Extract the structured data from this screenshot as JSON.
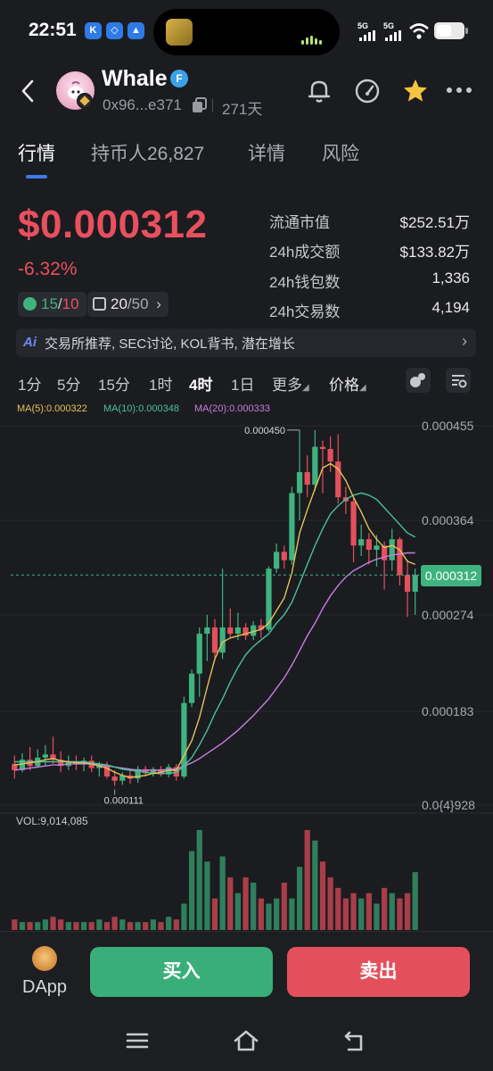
{
  "status_bar": {
    "time": "22:51",
    "app_icons": [
      "K",
      "◇",
      "▲"
    ],
    "signal_1": "5G",
    "signal_2": "5G"
  },
  "header": {
    "token_name": "Whale",
    "verified_badge": "F",
    "address": "0x96...e371",
    "age": "271天",
    "icons": [
      "back-icon",
      "copy-icon",
      "bell-icon",
      "gauge-icon",
      "star-icon",
      "more-icon"
    ]
  },
  "tabs": [
    {
      "label": "行情",
      "active": true
    },
    {
      "label": "持币人26,827",
      "active": false
    },
    {
      "label": "详情",
      "active": false
    },
    {
      "label": "风险",
      "active": false
    }
  ],
  "price": {
    "current": "$0.000312",
    "change": "-6.32%",
    "chip_1_value": "15",
    "chip_1_sep": "/",
    "chip_1_total": "10",
    "chip_2_value": "20",
    "chip_2_total": "/50",
    "chip_2_chevron": "›"
  },
  "stats": [
    {
      "label": "流通市值",
      "value": "$252.51万"
    },
    {
      "label": "24h成交额",
      "value": "$133.82万"
    },
    {
      "label": "24h钱包数",
      "value": "1,336"
    },
    {
      "label": "24h交易数",
      "value": "4,194"
    }
  ],
  "ai_banner": {
    "badge": "Ai",
    "text": "交易所推荐, SEC讨论, KOL背书, 潜在增长",
    "chevron": "›"
  },
  "intervals": [
    "1分",
    "5分",
    "15分",
    "1时",
    "4时",
    "1日",
    "更多",
    "价格"
  ],
  "active_interval": "4时",
  "ma_legend": {
    "ma5": "MA(5):0.000322",
    "ma10": "MA(10):0.000348",
    "ma20": "MA(20):0.000333"
  },
  "colors": {
    "up": "#3fb37f",
    "down": "#e3505c",
    "ma5": "#e3c35a",
    "ma10": "#46c29a",
    "ma20": "#c77de0",
    "accent": "#3c7be8"
  },
  "chart_data": {
    "type": "candlestick",
    "price_axis_labels": [
      "0.000455",
      "0.000364",
      "0.000274",
      "0.000183",
      "0.0{4}928"
    ],
    "last_price": "0.000312",
    "high_label": "0.000450",
    "low_label": "0.000111",
    "volume_label": "VOL:9,014,085",
    "ylim": [
      9.28e-05,
      0.000455
    ],
    "candles": [
      {
        "o": 0.000132,
        "h": 0.00014,
        "l": 0.000118,
        "c": 0.000126
      },
      {
        "o": 0.000126,
        "h": 0.000142,
        "l": 0.000124,
        "c": 0.000136
      },
      {
        "o": 0.000136,
        "h": 0.000148,
        "l": 0.000126,
        "c": 0.00013
      },
      {
        "o": 0.00013,
        "h": 0.000146,
        "l": 0.000128,
        "c": 0.000138
      },
      {
        "o": 0.000138,
        "h": 0.00015,
        "l": 0.00013,
        "c": 0.000141
      },
      {
        "o": 0.000141,
        "h": 0.000158,
        "l": 0.000132,
        "c": 0.000136
      },
      {
        "o": 0.000136,
        "h": 0.000144,
        "l": 0.000124,
        "c": 0.00013
      },
      {
        "o": 0.00013,
        "h": 0.00014,
        "l": 0.000126,
        "c": 0.000134
      },
      {
        "o": 0.000134,
        "h": 0.00014,
        "l": 0.000126,
        "c": 0.000132
      },
      {
        "o": 0.000132,
        "h": 0.000138,
        "l": 0.000125,
        "c": 0.000135
      },
      {
        "o": 0.000135,
        "h": 0.00014,
        "l": 0.000124,
        "c": 0.000128
      },
      {
        "o": 0.000128,
        "h": 0.000134,
        "l": 0.00012,
        "c": 0.000131
      },
      {
        "o": 0.000131,
        "h": 0.000134,
        "l": 0.000118,
        "c": 0.00012
      },
      {
        "o": 0.00012,
        "h": 0.000126,
        "l": 0.000111,
        "c": 0.000116
      },
      {
        "o": 0.000116,
        "h": 0.000124,
        "l": 0.000112,
        "c": 0.000121
      },
      {
        "o": 0.000121,
        "h": 0.000126,
        "l": 0.000113,
        "c": 0.000118
      },
      {
        "o": 0.000118,
        "h": 0.00013,
        "l": 0.000114,
        "c": 0.000127
      },
      {
        "o": 0.000127,
        "h": 0.00013,
        "l": 0.00012,
        "c": 0.000123
      },
      {
        "o": 0.000123,
        "h": 0.000129,
        "l": 0.00012,
        "c": 0.000127
      },
      {
        "o": 0.000127,
        "h": 0.00013,
        "l": 0.00012,
        "c": 0.000122
      },
      {
        "o": 0.000122,
        "h": 0.000132,
        "l": 0.000119,
        "c": 0.000129
      },
      {
        "o": 0.000129,
        "h": 0.000132,
        "l": 0.000116,
        "c": 0.00012
      },
      {
        "o": 0.00012,
        "h": 0.000196,
        "l": 0.000118,
        "c": 0.00019
      },
      {
        "o": 0.00019,
        "h": 0.000222,
        "l": 0.000186,
        "c": 0.000218
      },
      {
        "o": 0.000218,
        "h": 0.000262,
        "l": 0.000196,
        "c": 0.000256
      },
      {
        "o": 0.000256,
        "h": 0.000274,
        "l": 0.00023,
        "c": 0.000262
      },
      {
        "o": 0.000262,
        "h": 0.00027,
        "l": 0.000232,
        "c": 0.000238
      },
      {
        "o": 0.000238,
        "h": 0.000318,
        "l": 0.000232,
        "c": 0.000262
      },
      {
        "o": 0.000262,
        "h": 0.00028,
        "l": 0.000252,
        "c": 0.000256
      },
      {
        "o": 0.000256,
        "h": 0.000276,
        "l": 0.00025,
        "c": 0.000262
      },
      {
        "o": 0.000262,
        "h": 0.000266,
        "l": 0.00025,
        "c": 0.000254
      },
      {
        "o": 0.000254,
        "h": 0.000268,
        "l": 0.00025,
        "c": 0.000264
      },
      {
        "o": 0.000264,
        "h": 0.00027,
        "l": 0.000252,
        "c": 0.00026
      },
      {
        "o": 0.00026,
        "h": 0.00032,
        "l": 0.000258,
        "c": 0.000318
      },
      {
        "o": 0.000318,
        "h": 0.000342,
        "l": 0.000314,
        "c": 0.000334
      },
      {
        "o": 0.000334,
        "h": 0.00034,
        "l": 0.000318,
        "c": 0.000326
      },
      {
        "o": 0.000326,
        "h": 0.000396,
        "l": 0.000322,
        "c": 0.00039
      },
      {
        "o": 0.00039,
        "h": 0.00045,
        "l": 0.000364,
        "c": 0.00041
      },
      {
        "o": 0.00041,
        "h": 0.000426,
        "l": 0.000386,
        "c": 0.000398
      },
      {
        "o": 0.000398,
        "h": 0.00045,
        "l": 0.000392,
        "c": 0.000434
      },
      {
        "o": 0.000434,
        "h": 0.00044,
        "l": 0.00039,
        "c": 0.000432
      },
      {
        "o": 0.000432,
        "h": 0.000444,
        "l": 0.00041,
        "c": 0.00042
      },
      {
        "o": 0.00042,
        "h": 0.000446,
        "l": 0.00038,
        "c": 0.000386
      },
      {
        "o": 0.000386,
        "h": 0.000396,
        "l": 0.00037,
        "c": 0.000382
      },
      {
        "o": 0.000382,
        "h": 0.000386,
        "l": 0.000324,
        "c": 0.00034
      },
      {
        "o": 0.00034,
        "h": 0.00036,
        "l": 0.00033,
        "c": 0.000346
      },
      {
        "o": 0.000346,
        "h": 0.000352,
        "l": 0.000322,
        "c": 0.000336
      },
      {
        "o": 0.000336,
        "h": 0.00035,
        "l": 0.00032,
        "c": 0.00034
      },
      {
        "o": 0.00034,
        "h": 0.000344,
        "l": 0.000298,
        "c": 0.000326
      },
      {
        "o": 0.000326,
        "h": 0.000356,
        "l": 0.000316,
        "c": 0.000346
      },
      {
        "o": 0.000346,
        "h": 0.000348,
        "l": 0.000302,
        "c": 0.000312
      },
      {
        "o": 0.000312,
        "h": 0.000326,
        "l": 0.000272,
        "c": 0.000296
      },
      {
        "o": 0.000296,
        "h": 0.000318,
        "l": 0.000274,
        "c": 0.000312
      }
    ],
    "volume": [
      4,
      3,
      3,
      3,
      4,
      5,
      4,
      3,
      3,
      3,
      3,
      4,
      3,
      5,
      4,
      3,
      3,
      3,
      4,
      3,
      5,
      4,
      10,
      30,
      38,
      26,
      12,
      28,
      20,
      14,
      20,
      18,
      12,
      10,
      12,
      18,
      12,
      24,
      38,
      34,
      26,
      20,
      16,
      12,
      14,
      12,
      14,
      10,
      16,
      14,
      12,
      14,
      22
    ],
    "ma5": [
      0.000131,
      0.000132,
      0.000133,
      0.000134,
      0.000136,
      0.000137,
      0.000135,
      0.000134,
      0.000133,
      0.000133,
      0.000132,
      0.00013,
      0.000128,
      0.000124,
      0.000121,
      0.000119,
      0.00012,
      0.000121,
      0.000123,
      0.000124,
      0.000126,
      0.000126,
      0.00014,
      0.000154,
      0.000176,
      0.000205,
      0.000232,
      0.000248,
      0.000252,
      0.000254,
      0.000256,
      0.000258,
      0.00026,
      0.000266,
      0.000278,
      0.00029,
      0.000314,
      0.000352,
      0.000374,
      0.000394,
      0.000414,
      0.000418,
      0.000413,
      0.000402,
      0.000386,
      0.000372,
      0.000356,
      0.000346,
      0.000338,
      0.00034,
      0.000336,
      0.000325,
      0.000322
    ],
    "ma10": [
      0.000134,
      0.000134,
      0.000134,
      0.000134,
      0.000134,
      0.000134,
      0.000134,
      0.000134,
      0.000134,
      0.000134,
      0.000133,
      0.000132,
      0.000131,
      0.000129,
      0.000127,
      0.000126,
      0.000125,
      0.000124,
      0.000123,
      0.000123,
      0.000123,
      0.000124,
      0.00013,
      0.000138,
      0.00015,
      0.000164,
      0.00018,
      0.000194,
      0.00021,
      0.000224,
      0.000236,
      0.000244,
      0.00025,
      0.000256,
      0.000266,
      0.000274,
      0.000286,
      0.000304,
      0.000322,
      0.00034,
      0.000356,
      0.00037,
      0.000378,
      0.000384,
      0.000388,
      0.00039,
      0.000388,
      0.000384,
      0.000376,
      0.000368,
      0.00036,
      0.000352,
      0.000348
    ],
    "ma20": [
      0.000126,
      0.000127,
      0.000128,
      0.000129,
      0.00013,
      0.000131,
      0.000131,
      0.000132,
      0.000132,
      0.000132,
      0.000132,
      0.000131,
      0.00013,
      0.000129,
      0.000128,
      0.000127,
      0.000126,
      0.000126,
      0.000126,
      0.000126,
      0.000127,
      0.000127,
      0.00013,
      0.000133,
      0.000137,
      0.000142,
      0.000147,
      0.000152,
      0.000158,
      0.000164,
      0.000171,
      0.000178,
      0.000186,
      0.000194,
      0.000204,
      0.000214,
      0.000226,
      0.00024,
      0.000254,
      0.000266,
      0.00028,
      0.000292,
      0.000302,
      0.00031,
      0.000316,
      0.00032,
      0.000324,
      0.000327,
      0.000329,
      0.000331,
      0.000332,
      0.000333,
      0.000333
    ]
  },
  "bottom_bar": {
    "dapp_label": "DApp",
    "buy_label": "买入",
    "sell_label": "卖出"
  }
}
